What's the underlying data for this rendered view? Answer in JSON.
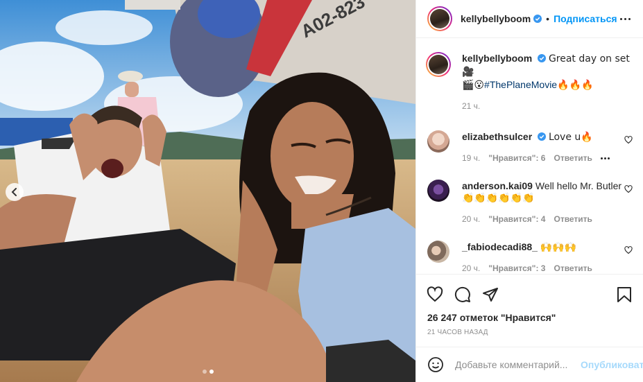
{
  "post": {
    "author": "kellybellyboom",
    "follow_label": "Подписаться",
    "caption": {
      "username": "kellybellyboom",
      "text": "Great day on set 🎥",
      "line2_prefix": "🎬😮",
      "hashtag": "#ThePlaneMovie",
      "line2_suffix": "🔥🔥🔥",
      "time": "21 ч."
    },
    "comments": [
      {
        "username": "elizabethsulcer",
        "verified": true,
        "text": "Love u🔥",
        "time": "19 ч.",
        "likes": "\"Нравится\": 6",
        "reply": "Ответить",
        "show_more": true
      },
      {
        "username": "anderson.kai09",
        "verified": false,
        "text": "Well hello Mr. Butler",
        "text_line2": "👏👏👏👏👏👏",
        "time": "20 ч.",
        "likes": "\"Нравится\": 4",
        "reply": "Ответить",
        "show_more": false
      },
      {
        "username": "_fabiodecadi88_",
        "verified": false,
        "text": "🙌🙌🙌",
        "time": "20 ч.",
        "likes": "\"Нравится\": 3",
        "reply": "Ответить",
        "show_more": false
      }
    ],
    "like_count": "26 247 отметок \"Нравится\"",
    "posted_ago": "21 часов назад",
    "comment_input": {
      "placeholder": "Добавьте комментарий...",
      "publish_label": "Опубликовать"
    },
    "aircraft_tail": "A02-823"
  },
  "icons": {
    "carousel_prev": "chevron-left-icon",
    "like": "heart-icon",
    "comment": "comment-icon",
    "share": "paper-plane-icon",
    "save": "bookmark-icon",
    "emoji": "smiley-icon",
    "verified": "verified-badge-icon"
  },
  "colors": {
    "accent": "#0095f6",
    "hashtag": "#00376b",
    "verified": "#3897f0",
    "muted": "#8e8e8e"
  },
  "carousel": {
    "total": 2,
    "active": 1
  }
}
